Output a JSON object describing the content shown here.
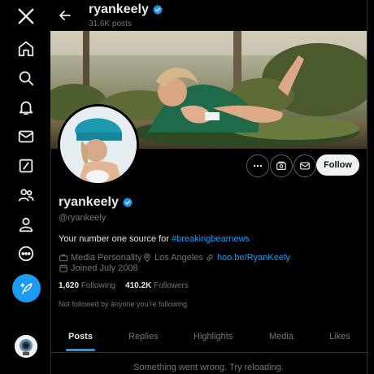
{
  "sidebar": {
    "items": [
      {
        "name": "x-logo",
        "icon": "x-logo-icon"
      },
      {
        "name": "home",
        "icon": "home-icon"
      },
      {
        "name": "explore",
        "icon": "search-icon"
      },
      {
        "name": "notifications",
        "icon": "bell-icon"
      },
      {
        "name": "messages",
        "icon": "mail-icon"
      },
      {
        "name": "grok",
        "icon": "grok-icon"
      },
      {
        "name": "communities",
        "icon": "people-icon"
      },
      {
        "name": "profile",
        "icon": "person-icon"
      },
      {
        "name": "more",
        "icon": "more-circle-icon"
      }
    ],
    "compose_icon": "feather-plus-icon"
  },
  "header": {
    "name": "ryankeely",
    "posts_count": "31.6K posts",
    "verified": true
  },
  "profile": {
    "display_name": "ryankeely",
    "handle": "@ryankeely",
    "bio_prefix": "Your number one source for ",
    "bio_hashtag": "#breakingbearnews",
    "category": "Media Personality",
    "location": "Los Angeles",
    "website": "hoo.be/RyanKeely",
    "joined": "Joined July 2008",
    "following_count": "1,620",
    "following_label": "Following",
    "followers_count": "410.2K",
    "followers_label": "Followers",
    "not_followed_text": "Not followed by anyone you’re following"
  },
  "actions": {
    "follow_label": "Follow"
  },
  "tabs": [
    {
      "label": "Posts",
      "active": true
    },
    {
      "label": "Replies",
      "active": false
    },
    {
      "label": "Highlights",
      "active": false
    },
    {
      "label": "Media",
      "active": false
    },
    {
      "label": "Likes",
      "active": false
    }
  ],
  "error_text": "Something went wrong. Try reloading.",
  "colors": {
    "accent": "#1d9bf0",
    "background": "#000000",
    "text": "#e7e9ea",
    "muted": "#71767b"
  }
}
